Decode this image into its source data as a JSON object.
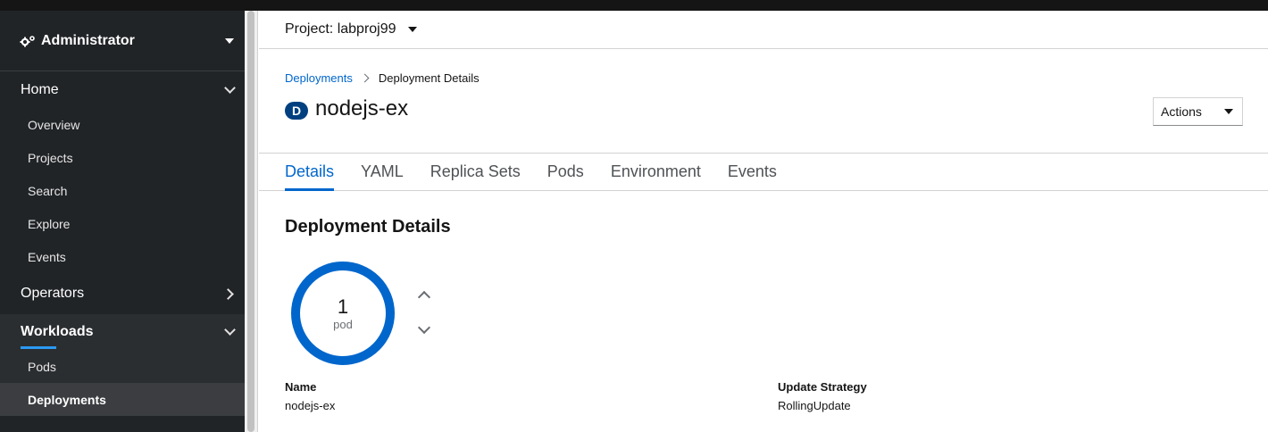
{
  "sidebar": {
    "perspective": {
      "label": "Administrator",
      "icon": "cogs-icon"
    },
    "home": {
      "label": "Home",
      "items": [
        "Overview",
        "Projects",
        "Search",
        "Explore",
        "Events"
      ]
    },
    "operators": {
      "label": "Operators"
    },
    "workloads": {
      "label": "Workloads",
      "items": [
        "Pods",
        "Deployments"
      ],
      "current": "Deployments"
    },
    "accent_color": "#2b9af3"
  },
  "project": {
    "label": "Project: labproj99"
  },
  "breadcrumb": {
    "parent": "Deployments",
    "current": "Deployment Details"
  },
  "resource": {
    "badge": "D",
    "name": "nodejs-ex",
    "badge_color": "#004080"
  },
  "actions": {
    "label": "Actions"
  },
  "tabs": [
    "Details",
    "YAML",
    "Replica Sets",
    "Pods",
    "Environment",
    "Events"
  ],
  "active_tab": "Details",
  "details": {
    "section_title": "Deployment Details",
    "pod_count": "1",
    "pod_unit": "pod",
    "ring_color": "#0066cc",
    "fields": {
      "name_label": "Name",
      "name_value": "nodejs-ex",
      "strategy_label": "Update Strategy",
      "strategy_value": "RollingUpdate"
    }
  }
}
